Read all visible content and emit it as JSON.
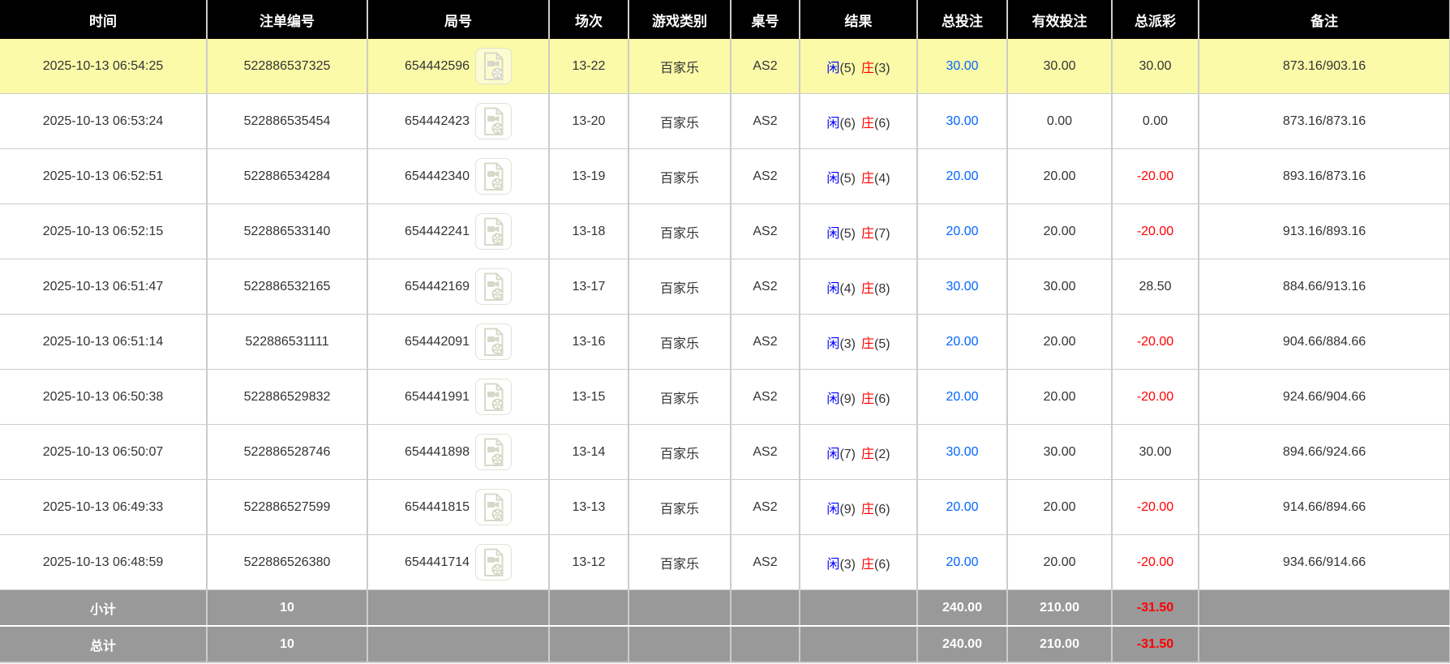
{
  "table": {
    "columns": [
      {
        "label": "时间"
      },
      {
        "label": "注单编号"
      },
      {
        "label": "局号"
      },
      {
        "label": "场次"
      },
      {
        "label": "游戏类别"
      },
      {
        "label": "桌号"
      },
      {
        "label": "结果"
      },
      {
        "label": "总投注"
      },
      {
        "label": "有效投注"
      },
      {
        "label": "总派彩"
      },
      {
        "label": "备注"
      }
    ],
    "rows": [
      {
        "time": "2025-10-13 06:54:25",
        "bet_id": "522886537325",
        "round": "654442596",
        "session": "13-22",
        "game_type": "百家乐",
        "table_no": "AS2",
        "result_player": "闲",
        "result_player_pts": "(5)",
        "result_banker": "庄",
        "result_banker_pts": "(3)",
        "total_bet": "30.00",
        "valid_bet": "30.00",
        "total_payout": "30.00",
        "remark": "873.16/903.16",
        "highlighted": true
      },
      {
        "time": "2025-10-13 06:53:24",
        "bet_id": "522886535454",
        "round": "654442423",
        "session": "13-20",
        "game_type": "百家乐",
        "table_no": "AS2",
        "result_player": "闲",
        "result_player_pts": "(6)",
        "result_banker": "庄",
        "result_banker_pts": "(6)",
        "total_bet": "30.00",
        "valid_bet": "0.00",
        "total_payout": "0.00",
        "remark": "873.16/873.16",
        "highlighted": false
      },
      {
        "time": "2025-10-13 06:52:51",
        "bet_id": "522886534284",
        "round": "654442340",
        "session": "13-19",
        "game_type": "百家乐",
        "table_no": "AS2",
        "result_player": "闲",
        "result_player_pts": "(5)",
        "result_banker": "庄",
        "result_banker_pts": "(4)",
        "total_bet": "20.00",
        "valid_bet": "20.00",
        "total_payout": "-20.00",
        "remark": "893.16/873.16",
        "highlighted": false
      },
      {
        "time": "2025-10-13 06:52:15",
        "bet_id": "522886533140",
        "round": "654442241",
        "session": "13-18",
        "game_type": "百家乐",
        "table_no": "AS2",
        "result_player": "闲",
        "result_player_pts": "(5)",
        "result_banker": "庄",
        "result_banker_pts": "(7)",
        "total_bet": "20.00",
        "valid_bet": "20.00",
        "total_payout": "-20.00",
        "remark": "913.16/893.16",
        "highlighted": false
      },
      {
        "time": "2025-10-13 06:51:47",
        "bet_id": "522886532165",
        "round": "654442169",
        "session": "13-17",
        "game_type": "百家乐",
        "table_no": "AS2",
        "result_player": "闲",
        "result_player_pts": "(4)",
        "result_banker": "庄",
        "result_banker_pts": "(8)",
        "total_bet": "30.00",
        "valid_bet": "30.00",
        "total_payout": "28.50",
        "remark": "884.66/913.16",
        "highlighted": false
      },
      {
        "time": "2025-10-13 06:51:14",
        "bet_id": "522886531111",
        "round": "654442091",
        "session": "13-16",
        "game_type": "百家乐",
        "table_no": "AS2",
        "result_player": "闲",
        "result_player_pts": "(3)",
        "result_banker": "庄",
        "result_banker_pts": "(5)",
        "total_bet": "20.00",
        "valid_bet": "20.00",
        "total_payout": "-20.00",
        "remark": "904.66/884.66",
        "highlighted": false
      },
      {
        "time": "2025-10-13 06:50:38",
        "bet_id": "522886529832",
        "round": "654441991",
        "session": "13-15",
        "game_type": "百家乐",
        "table_no": "AS2",
        "result_player": "闲",
        "result_player_pts": "(9)",
        "result_banker": "庄",
        "result_banker_pts": "(6)",
        "total_bet": "20.00",
        "valid_bet": "20.00",
        "total_payout": "-20.00",
        "remark": "924.66/904.66",
        "highlighted": false
      },
      {
        "time": "2025-10-13 06:50:07",
        "bet_id": "522886528746",
        "round": "654441898",
        "session": "13-14",
        "game_type": "百家乐",
        "table_no": "AS2",
        "result_player": "闲",
        "result_player_pts": "(7)",
        "result_banker": "庄",
        "result_banker_pts": "(2)",
        "total_bet": "30.00",
        "valid_bet": "30.00",
        "total_payout": "30.00",
        "remark": "894.66/924.66",
        "highlighted": false
      },
      {
        "time": "2025-10-13 06:49:33",
        "bet_id": "522886527599",
        "round": "654441815",
        "session": "13-13",
        "game_type": "百家乐",
        "table_no": "AS2",
        "result_player": "闲",
        "result_player_pts": "(9)",
        "result_banker": "庄",
        "result_banker_pts": "(6)",
        "total_bet": "20.00",
        "valid_bet": "20.00",
        "total_payout": "-20.00",
        "remark": "914.66/894.66",
        "highlighted": false
      },
      {
        "time": "2025-10-13 06:48:59",
        "bet_id": "522886526380",
        "round": "654441714",
        "session": "13-12",
        "game_type": "百家乐",
        "table_no": "AS2",
        "result_player": "闲",
        "result_player_pts": "(3)",
        "result_banker": "庄",
        "result_banker_pts": "(6)",
        "total_bet": "20.00",
        "valid_bet": "20.00",
        "total_payout": "-20.00",
        "remark": "934.66/914.66",
        "highlighted": false
      }
    ],
    "summary_rows": [
      {
        "label": "小计",
        "count": "10",
        "total_bet": "240.00",
        "valid_bet": "210.00",
        "total_payout": "-31.50"
      },
      {
        "label": "总计",
        "count": "10",
        "total_bet": "240.00",
        "valid_bet": "210.00",
        "total_payout": "-31.50"
      }
    ]
  },
  "icons": {
    "round_video": "video-file-icon"
  },
  "colors": {
    "header_bg": "#000000",
    "highlight_yellow": "#FAFAA9",
    "summary_gray": "#999999",
    "amount_blue": "#0066FF",
    "player_blue": "#0000FF",
    "banker_red": "#FF0000",
    "negative_red": "#FF0000",
    "border_gray": "#CCCCCC"
  }
}
